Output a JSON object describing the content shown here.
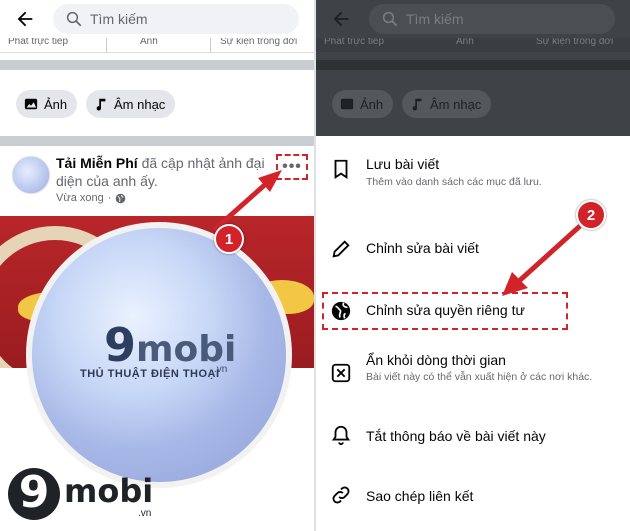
{
  "left": {
    "search": {
      "placeholder": "Tìm kiếm"
    },
    "create_bar": {
      "items": [
        "Phát trực tiếp",
        "Ảnh",
        "Sự kiện trong đời"
      ]
    },
    "chips": [
      "Ảnh",
      "Âm nhạc"
    ],
    "post": {
      "author": "Tải Miễn Phí",
      "action": " đã cập nhật ảnh đại diện của anh ấy.",
      "time": "Vừa xong",
      "more_label": "•••"
    },
    "watermark": {
      "brand_nine": "9",
      "brand_text": "mobi",
      "brand_tld": ".vn",
      "tagline": "THỦ THUẬT ĐIỆN THOẠI"
    },
    "logo": {
      "nine": "9",
      "text": "mobi",
      "tld": ".vn"
    },
    "badge": "1"
  },
  "right": {
    "search": {
      "placeholder": "Tìm kiếm"
    },
    "create_bar": {
      "items": [
        "Phát trực tiếp",
        "Ảnh",
        "Sự kiện trong đời"
      ]
    },
    "chips": [
      "Ảnh",
      "Âm nhạc"
    ],
    "menu": [
      {
        "icon": "bookmark-icon",
        "title": "Lưu bài viết",
        "subtitle": "Thêm vào danh sách các mục đã lưu."
      },
      {
        "icon": "pencil-icon",
        "title": "Chỉnh sửa bài viết",
        "subtitle": ""
      },
      {
        "icon": "globe-icon",
        "title": "Chỉnh sửa quyền riêng tư",
        "subtitle": ""
      },
      {
        "icon": "hide-box-icon",
        "title": "Ẩn khỏi dòng thời gian",
        "subtitle": "Bài viết này có thể vẫn xuất hiện ở các nơi khác."
      },
      {
        "icon": "bell-icon",
        "title": "Tắt thông báo về bài viết này",
        "subtitle": ""
      },
      {
        "icon": "link-icon",
        "title": "Sao chép liên kết",
        "subtitle": ""
      }
    ],
    "badge": "2"
  },
  "colors": {
    "annotation_red": "#d2232a",
    "facebook_text": "#050505",
    "secondary_text": "#65676b"
  }
}
